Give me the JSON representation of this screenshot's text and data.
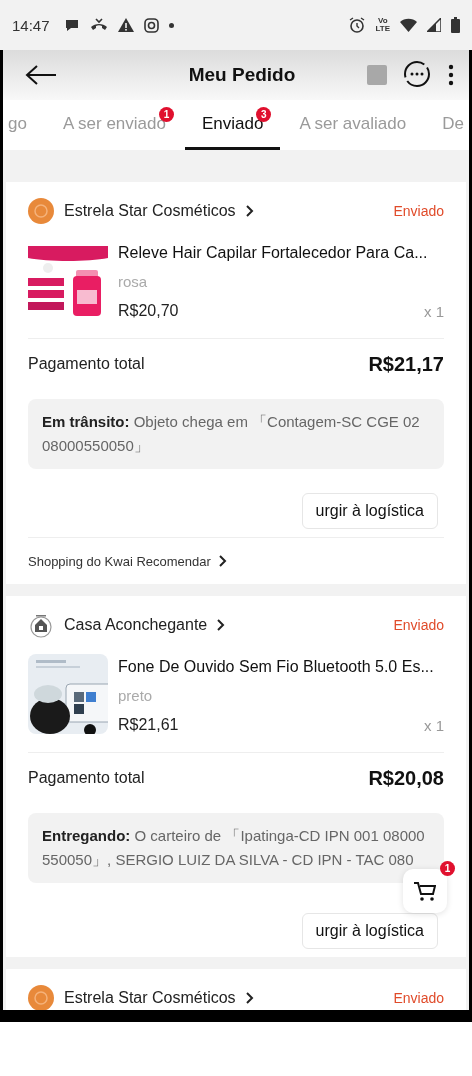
{
  "status_bar": {
    "time": "14:47",
    "network_label": "Vo\nLTE"
  },
  "header": {
    "title": "Meu Pedido"
  },
  "tabs": [
    {
      "label": "go",
      "selected": false
    },
    {
      "label": "A ser enviado",
      "badge": "1",
      "selected": false
    },
    {
      "label": "Enviado",
      "badge": "3",
      "selected": true
    },
    {
      "label": "A ser avaliado",
      "selected": false
    },
    {
      "label": "De",
      "selected": false
    }
  ],
  "orders": [
    {
      "store": "Estrela Star Cosméticos",
      "logo": {
        "kind": "circle"
      },
      "status": "Enviado",
      "item": {
        "title": "Releve Hair Capilar Fortalecedor Para Ca...",
        "variant": "rosa",
        "price": "R$20,70",
        "quantity": "x 1"
      },
      "total_label": "Pagamento total",
      "total": "R$21,17",
      "tracking": "**Em trânsito:**  Objeto chega em 「Contagem-SC CGE 02 08000550050」",
      "button": "urgir à logística",
      "recommend": "Shopping do Kwai Recomendar"
    },
    {
      "store": "Casa Aconchegante",
      "logo": {
        "kind": "house"
      },
      "status": "Enviado",
      "item": {
        "title": "Fone De Ouvido Sem Fio Bluetooth 5.0 Es...",
        "variant": "preto",
        "price": "R$21,61",
        "quantity": "x 1"
      },
      "total_label": "Pagamento total",
      "total": "R$20,08",
      "tracking": "**Entregando:**  O carteiro de 「Ipatinga-CD IPN 001 08000550050」, SERGIO LUIZ DA SILVA - CD IPN - TAC 080",
      "button": "urgir à logística"
    },
    {
      "store": "Estrela Star Cosméticos",
      "logo": {
        "kind": "circle"
      },
      "status": "Enviado"
    }
  ],
  "cart_button": {
    "badge": "1"
  }
}
